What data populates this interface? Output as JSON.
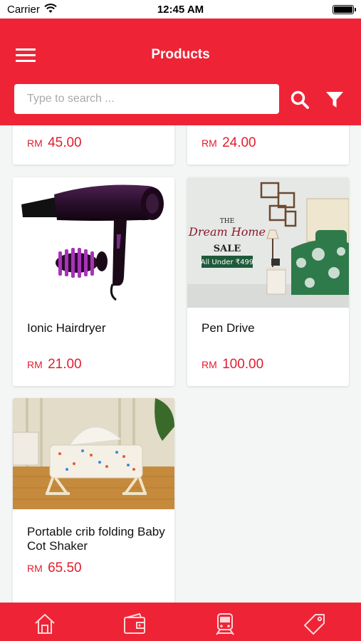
{
  "status_bar": {
    "carrier": "Carrier",
    "time": "12:45 AM"
  },
  "header": {
    "title": "Products"
  },
  "search": {
    "placeholder": "Type to search ..."
  },
  "products": [
    {
      "name": "",
      "currency": "RM",
      "price": "45.00"
    },
    {
      "name": "",
      "currency": "RM",
      "price": "24.00"
    },
    {
      "name": "Ionic Hairdryer",
      "currency": "RM",
      "price": "21.00"
    },
    {
      "name": "Pen Drive",
      "currency": "RM",
      "price": "100.00"
    },
    {
      "name": "Portable crib folding Baby Cot Shaker",
      "currency": "RM",
      "price": "65.50"
    }
  ],
  "promo_banner": {
    "line1": "THE",
    "line2": "Dream Home",
    "line3": "SALE",
    "line4": "All Under ₹499"
  },
  "tabs": [
    {
      "icon": "home-icon"
    },
    {
      "icon": "wallet-icon"
    },
    {
      "icon": "train-icon"
    },
    {
      "icon": "tag-icon"
    }
  ],
  "colors": {
    "brand": "#ee2436",
    "price": "#e11d2f",
    "background": "#f3f6f4"
  }
}
